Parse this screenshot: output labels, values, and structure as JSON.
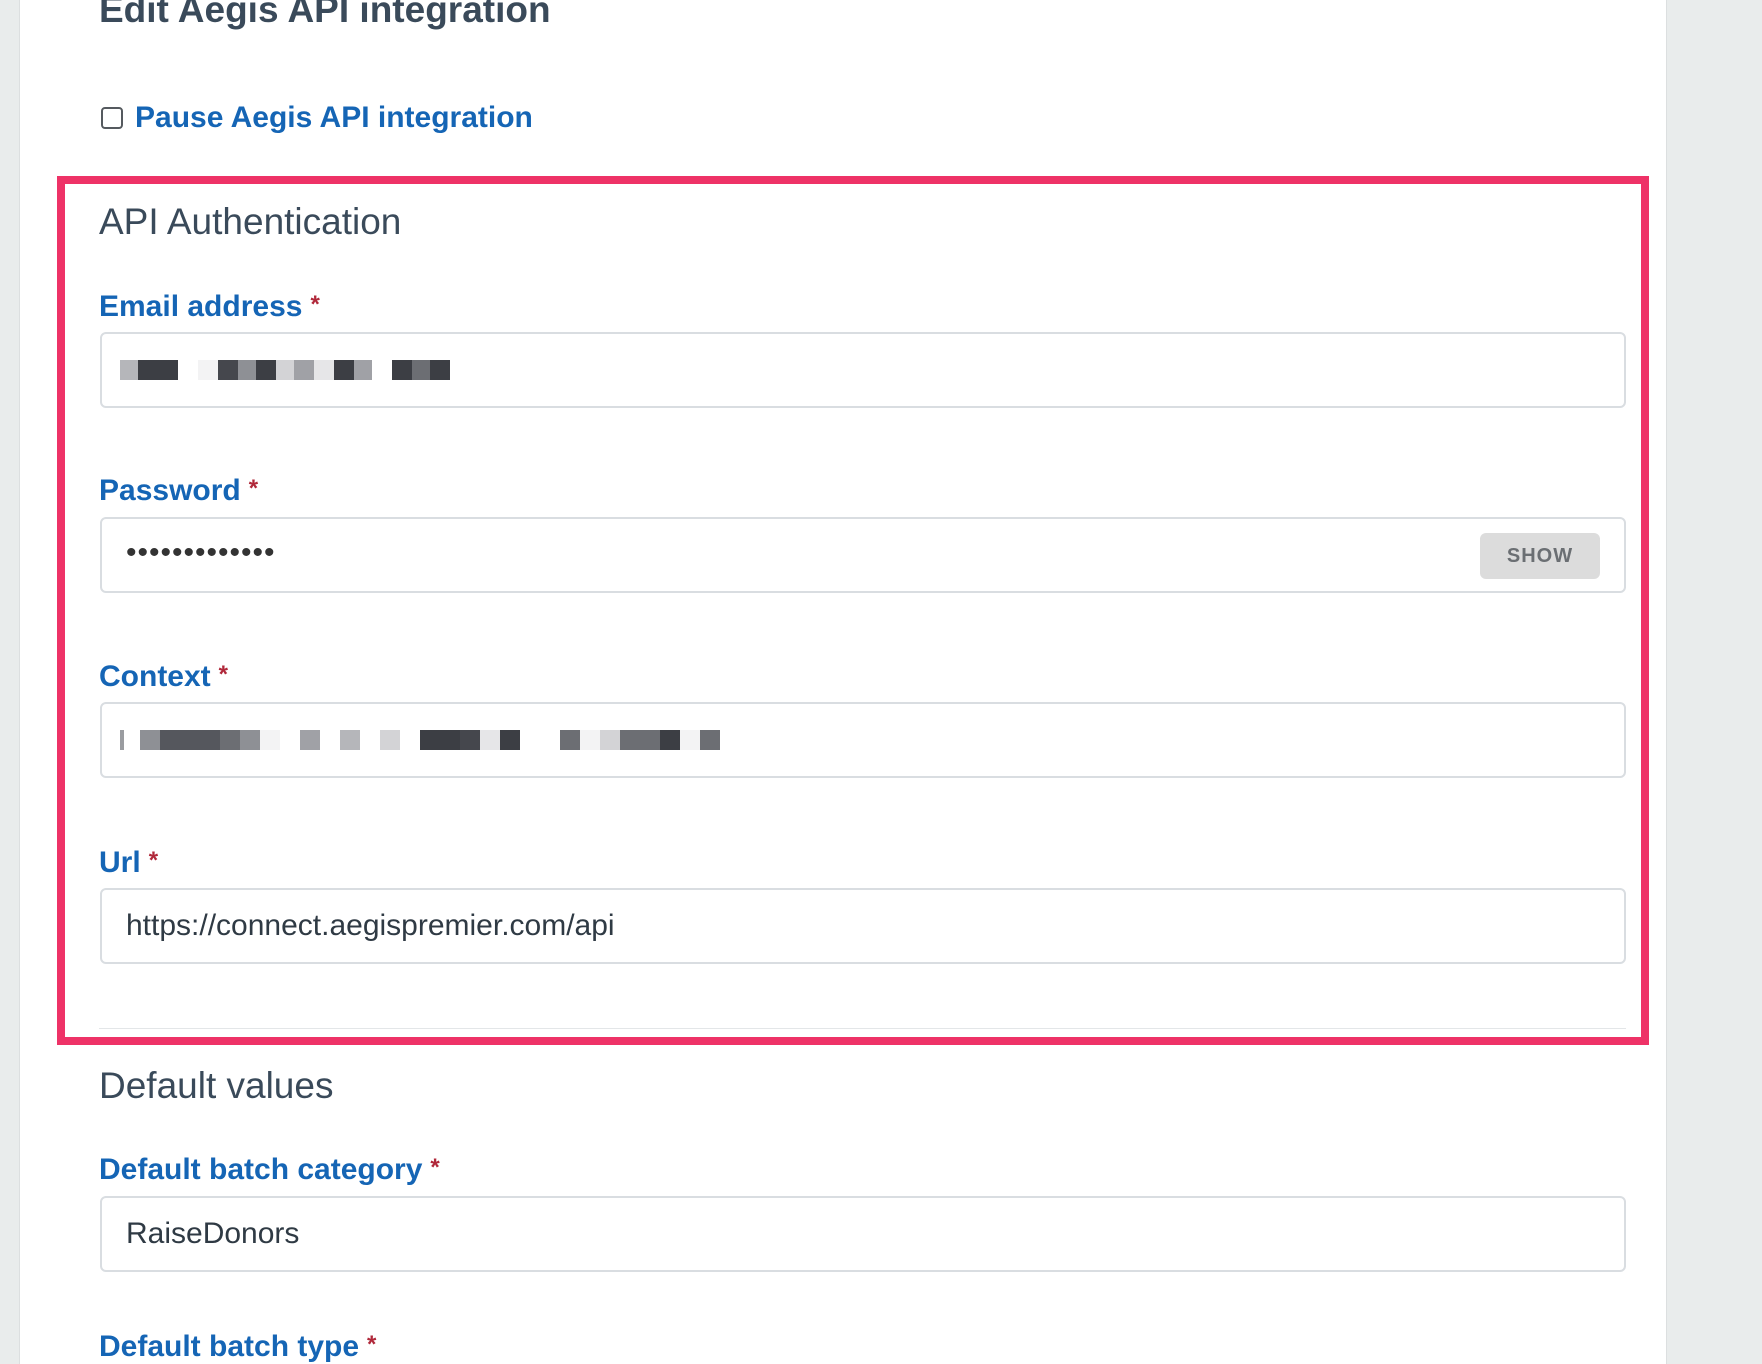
{
  "page": {
    "title": "Edit Aegis API integration",
    "pause_label": "Pause Aegis API integration"
  },
  "api_auth": {
    "heading": "API Authentication",
    "email": {
      "label": "Email address",
      "required_mark": "*"
    },
    "password": {
      "label": "Password",
      "required_mark": "*",
      "value_masked": "•••••••••••••",
      "show_label": "SHOW"
    },
    "context": {
      "label": "Context",
      "required_mark": "*"
    },
    "url": {
      "label": "Url",
      "required_mark": "*",
      "value": "https://connect.aegispremier.com/api"
    }
  },
  "defaults": {
    "heading": "Default values",
    "batch_category": {
      "label": "Default batch category",
      "required_mark": "*",
      "value": "RaiseDonors"
    },
    "batch_type": {
      "label": "Default batch type",
      "required_mark": "*"
    }
  },
  "colors": {
    "highlight": "#ee3267",
    "label_blue": "#1565b5",
    "heading_gray": "#3a4a5a",
    "required_red": "#b0283a"
  }
}
